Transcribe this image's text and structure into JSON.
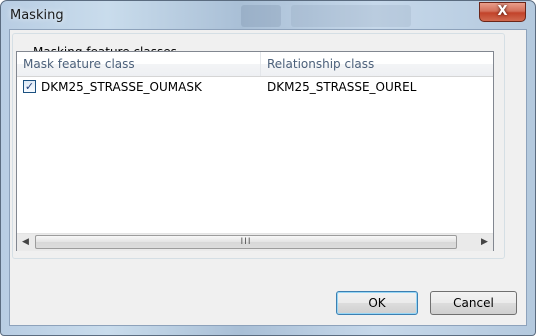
{
  "window": {
    "title": "Masking",
    "close_label": "X"
  },
  "group": {
    "legend": "Masking feature classes"
  },
  "list": {
    "columns": [
      "Mask feature class",
      "Relationship class"
    ],
    "rows": [
      {
        "checked": true,
        "check_glyph": "✓",
        "mask_feature_class": "DKM25_STRASSE_OUMASK",
        "relationship_class": "DKM25_STRASSE_OUREL"
      }
    ],
    "scrollbar": {
      "left_arrow": "◀",
      "right_arrow": "▶",
      "grip": "III"
    }
  },
  "buttons": {
    "ok": "OK",
    "cancel": "Cancel"
  },
  "colors": {
    "close_button": "#c2432a",
    "accent": "#3c7fb1"
  }
}
